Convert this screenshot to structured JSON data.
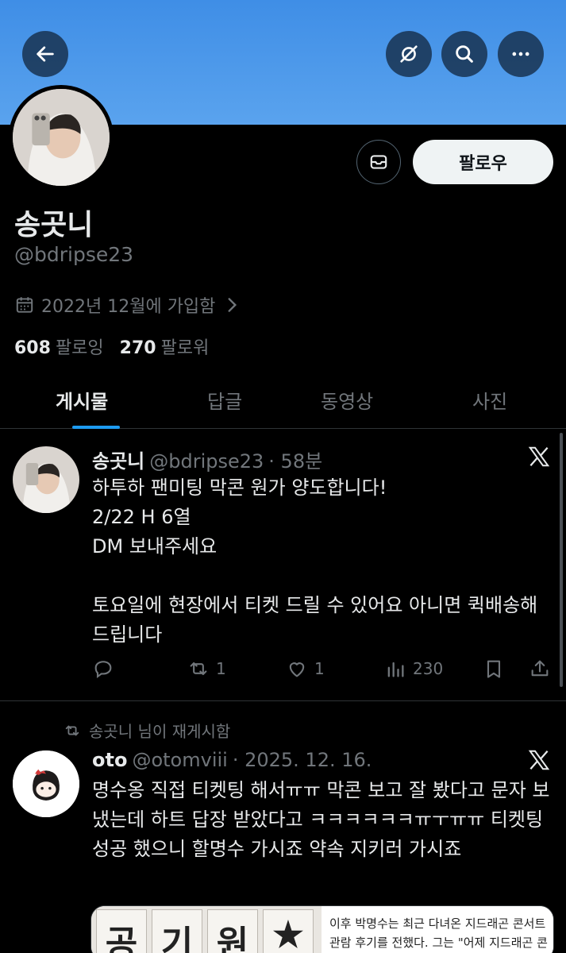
{
  "profile": {
    "name": "송곳니",
    "handle": "@bdripse23",
    "joined": "2022년 12월에 가입함",
    "following_count": "608",
    "following_label": "팔로잉",
    "followers_count": "270",
    "followers_label": "팔로워",
    "follow_label": "팔로우"
  },
  "tabs": [
    "게시물",
    "답글",
    "동영상",
    "사진"
  ],
  "posts": [
    {
      "name": "송곳니",
      "handle": "@bdripse23",
      "time": "· 58분",
      "text": "하투하 팬미팅 막콘 원가 양도합니다!\n2/22 H 6열\nDM 보내주세요\n\n토요일에 현장에서 티켓 드릴 수 있어요 아니면 퀵배송해드립니다",
      "retweets": "1",
      "likes": "1",
      "views": "230"
    },
    {
      "repost_label": "송곳니 님이 재게시함",
      "name": "oto",
      "handle": "@otomviii",
      "time": "· 2025. 12. 16.",
      "text": "명수옹 직접 티켓팅 해서ㅠㅠ 막콘 보고 잘 봤다고 문자 보냈는데 하트 답장 받았다고 ㅋㅋㅋㅋㅋㅋㅠㅜㅠㅠ 티켓팅 성공 했으니 할명수 가시죠 약속 지키러 가시죠",
      "media_chars": [
        "공",
        "기",
        "원",
        "★"
      ],
      "media_text": "이후 박명수는 최근 다녀온 지드래곤 콘서트 관람 후기를 전했다. 그는 \"어제 지드래곤 콘"
    }
  ],
  "colors": {
    "banner": "#4a96ea",
    "accent": "#1d9bf0",
    "muted": "#71767b"
  },
  "icons": {
    "back": "arrow-left-icon",
    "hide": "eye-slash-icon",
    "search": "search-icon",
    "more": "ellipsis-icon",
    "message": "envelope-icon",
    "calendar": "calendar-icon",
    "x": "x-logo-icon"
  }
}
